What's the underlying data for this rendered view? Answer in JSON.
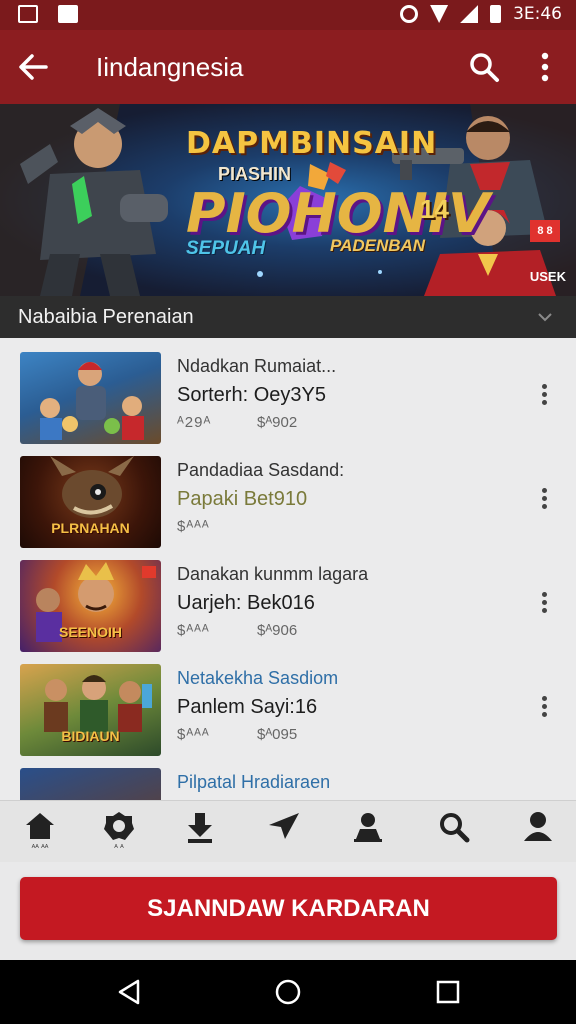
{
  "status_bar": {
    "time": "3E:46",
    "icons": [
      "gallery-icon",
      "message-icon",
      "alarm-icon",
      "wifi-icon",
      "signal-icon",
      "battery-icon"
    ]
  },
  "app_bar": {
    "title": "Iindangnesia",
    "icons": [
      "back-arrow-icon",
      "search-icon",
      "more-vert-icon"
    ]
  },
  "banner": {
    "line1": "DAPMBINSAIN",
    "line2": "PIASHIN",
    "line3": "PIOHONIV",
    "number": "14",
    "line4": "SEPUAH",
    "line5": "PADENBAN",
    "badge": "8 8",
    "corner": "USEK"
  },
  "section": {
    "title": "Nabaibia Perenaian"
  },
  "items": [
    {
      "title": "Ndadkan Rumaiat...",
      "subtitle": "Sorterh: Oey3Y5",
      "meta": "ᴬ29ᴬ",
      "price": "$ᴬ902",
      "thumb_label": "",
      "title_color": "#333333",
      "subtitle_color": "#1d1d1d"
    },
    {
      "title": "Pandadiaa Sasdand:",
      "subtitle": "Papaki Bet910",
      "meta": "$ᴬᴬᴬ",
      "price": "",
      "thumb_label": "PLRNAHAN",
      "title_color": "#333333",
      "subtitle_color": "#7a7a3a"
    },
    {
      "title": "Danakan kunmm lagara",
      "subtitle": "Uarjeh: Bek016",
      "meta": "$ᴬᴬᴬ",
      "price": "$ᴬ906",
      "thumb_label": "SEENOIH",
      "title_color": "#333333",
      "subtitle_color": "#1d1d1d"
    },
    {
      "title": "Netakekha Sasdiom",
      "subtitle": "Panlem Sayi:16",
      "meta": "$ᴬᴬᴬ",
      "price": "$ᴬ095",
      "thumb_label": "BIDIAUN",
      "title_color": "#2f6fa7",
      "subtitle_color": "#1d1d1d"
    },
    {
      "title": "Pilpatal Hradiaraen",
      "subtitle": "",
      "meta": "",
      "price": "",
      "thumb_label": "",
      "title_color": "#2f6fa7",
      "subtitle_color": "#1d1d1d"
    }
  ],
  "bottom_nav": [
    {
      "icon": "home-icon",
      "caption": "ᴬᴬ ᴬᴬ"
    },
    {
      "icon": "gear-icon",
      "caption": "ᴬ ᴬ"
    },
    {
      "icon": "download-icon",
      "caption": ""
    },
    {
      "icon": "send-icon",
      "caption": ""
    },
    {
      "icon": "user-pin-icon",
      "caption": ""
    },
    {
      "icon": "search-icon",
      "caption": ""
    },
    {
      "icon": "profile-icon",
      "caption": ""
    }
  ],
  "cta": {
    "label": "SJANNDAW KARDARAN"
  },
  "colors": {
    "status_bar": "#7b1a1c",
    "app_bar": "#8c1d20",
    "cta": "#c41922",
    "section_bar": "#2d2d2d",
    "list_bg": "#ebebec"
  }
}
